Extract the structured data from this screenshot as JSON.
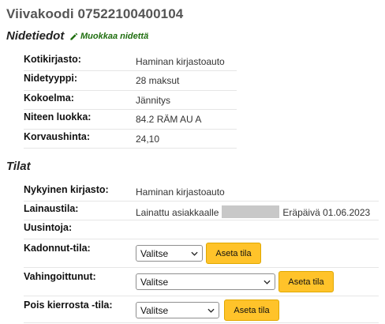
{
  "title": "Viivakoodi 07522100400104",
  "details": {
    "heading": "Nidetiedot",
    "edit_link": "Muokkaa nidettä",
    "rows": [
      {
        "label": "Kotikirjasto:",
        "value": "Haminan kirjastoauto"
      },
      {
        "label": "Nidetyyppi:",
        "value": "28 maksut"
      },
      {
        "label": "Kokoelma:",
        "value": "Jännitys"
      },
      {
        "label": "Niteen luokka:",
        "value": "84.2 RÄM AU A"
      },
      {
        "label": "Korvaushinta:",
        "value": "24,10"
      }
    ]
  },
  "status": {
    "heading": "Tilat",
    "current_library": {
      "label": "Nykyinen kirjasto:",
      "value": "Haminan kirjastoauto"
    },
    "loan_status": {
      "label": "Lainaustila:",
      "prefix": "Lainattu asiakkaalle",
      "due": "Eräpäivä 01.06.2023"
    },
    "renewals": {
      "label": "Uusintoja:",
      "value": ""
    },
    "lost": {
      "label": "Kadonnut-tila:",
      "select": "Valitse",
      "button": "Aseta tila"
    },
    "damaged": {
      "label": "Vahingoittunut:",
      "select": "Valitse",
      "button": "Aseta tila"
    },
    "withdrawn": {
      "label": "Pois kierrosta -tila:",
      "select": "Valitse",
      "button": "Aseta tila"
    }
  },
  "colors": {
    "button": "#ffc32a",
    "edit_link": "#1f6e0f",
    "title": "#555555"
  }
}
